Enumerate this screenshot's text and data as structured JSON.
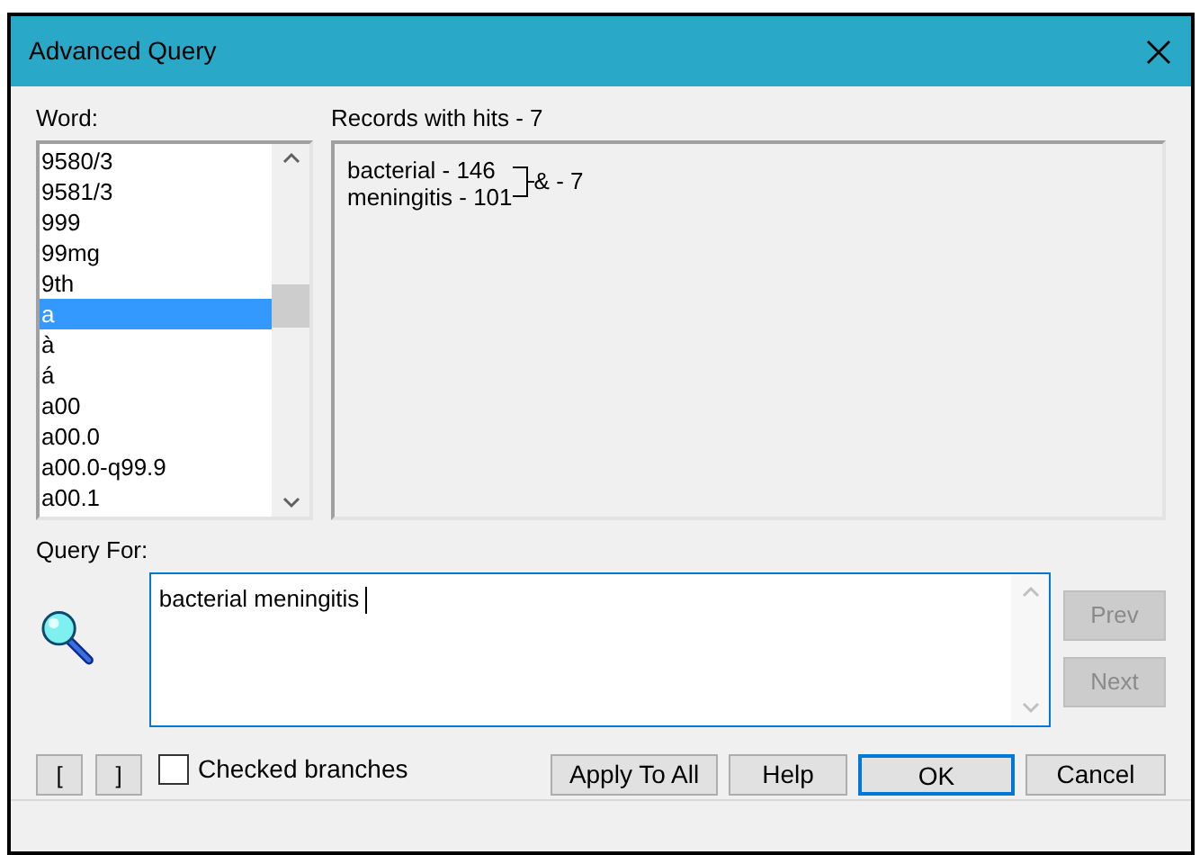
{
  "window": {
    "title": "Advanced Query"
  },
  "word_list": {
    "label": "Word:",
    "items": [
      {
        "text": "9580/3",
        "selected": false
      },
      {
        "text": "9581/3",
        "selected": false
      },
      {
        "text": "999",
        "selected": false
      },
      {
        "text": "99mg",
        "selected": false
      },
      {
        "text": "9th",
        "selected": false
      },
      {
        "text": "a",
        "selected": true
      },
      {
        "text": "à",
        "selected": false
      },
      {
        "text": "á",
        "selected": false
      },
      {
        "text": "a00",
        "selected": false
      },
      {
        "text": "a00.0",
        "selected": false
      },
      {
        "text": "a00.0-q99.9",
        "selected": false
      },
      {
        "text": "a00.1",
        "selected": false
      }
    ]
  },
  "records": {
    "label": "Records with hits - 7",
    "terms": [
      "bacterial - 146",
      "meningitis - 101"
    ],
    "result": "& - 7"
  },
  "query": {
    "label": "Query For:",
    "value": "bacterial meningitis "
  },
  "side_buttons": [
    {
      "label": "Prev",
      "disabled": true
    },
    {
      "label": "Next",
      "disabled": true
    }
  ],
  "bracket_buttons": [
    "[",
    "]"
  ],
  "checked_branches": {
    "label": "Checked branches",
    "checked": false
  },
  "buttons": [
    {
      "label": "Apply To All",
      "default": false
    },
    {
      "label": "Help",
      "default": false
    },
    {
      "label": "OK",
      "default": true
    },
    {
      "label": "Cancel",
      "default": false
    }
  ]
}
